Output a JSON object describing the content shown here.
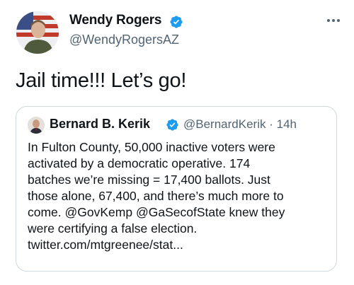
{
  "tweet": {
    "author_name": "Wendy Rogers",
    "author_handle": "@WendyRogersAZ",
    "text": "Jail time!!! Let’s go!",
    "more_icon": "ellipsis-icon",
    "verified_icon": "verified-badge-icon"
  },
  "quoted_tweet": {
    "author_name": "Bernard B. Kerik",
    "author_handle": "@BernardKerik",
    "separator": "·",
    "time_ago": "14h",
    "lines": [
      "In Fulton County, 50,000 inactive voters were",
      "activated by a democratic operative. 174",
      "batches we’re missing = 17,400 ballots. Just",
      "those alone, 67,400, and there’s much more to",
      "come.  @GovKemp @GaSecofState knew they",
      "were certifying a false election.",
      "twitter.com/mtgreenee/stat..."
    ]
  },
  "colors": {
    "text": "#0f1419",
    "secondary": "#536471",
    "verified": "#1d9bf0",
    "border": "#cfd9de"
  }
}
